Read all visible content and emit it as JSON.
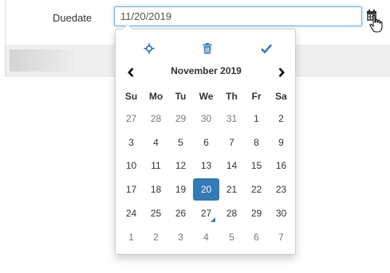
{
  "form": {
    "label": "Duedate",
    "value": "11/20/2019",
    "calendar_button_icon": "calendar-icon"
  },
  "picker": {
    "toolbar": [
      {
        "name": "today-crosshair-icon",
        "color": "#337ab7"
      },
      {
        "name": "clear-trash-icon",
        "color": "#337ab7"
      },
      {
        "name": "close-check-icon",
        "color": "#337ab7"
      }
    ],
    "prev_icon": "chevron-left-icon",
    "next_icon": "chevron-right-icon",
    "month_title": "November 2019",
    "weekdays": [
      "Su",
      "Mo",
      "Tu",
      "We",
      "Th",
      "Fr",
      "Sa"
    ],
    "weeks": [
      [
        {
          "d": "27",
          "o": true
        },
        {
          "d": "28",
          "o": true
        },
        {
          "d": "29",
          "o": true
        },
        {
          "d": "30",
          "o": true
        },
        {
          "d": "31",
          "o": true
        },
        {
          "d": "1"
        },
        {
          "d": "2"
        }
      ],
      [
        {
          "d": "3"
        },
        {
          "d": "4"
        },
        {
          "d": "5"
        },
        {
          "d": "6"
        },
        {
          "d": "7"
        },
        {
          "d": "8"
        },
        {
          "d": "9"
        }
      ],
      [
        {
          "d": "10"
        },
        {
          "d": "11"
        },
        {
          "d": "12"
        },
        {
          "d": "13"
        },
        {
          "d": "14"
        },
        {
          "d": "15"
        },
        {
          "d": "16"
        }
      ],
      [
        {
          "d": "17"
        },
        {
          "d": "18"
        },
        {
          "d": "19"
        },
        {
          "d": "20",
          "active": true
        },
        {
          "d": "21"
        },
        {
          "d": "22"
        },
        {
          "d": "23"
        }
      ],
      [
        {
          "d": "24"
        },
        {
          "d": "25"
        },
        {
          "d": "26"
        },
        {
          "d": "27",
          "today": true
        },
        {
          "d": "28"
        },
        {
          "d": "29"
        },
        {
          "d": "30"
        }
      ],
      [
        {
          "d": "1",
          "o": true
        },
        {
          "d": "2",
          "o": true
        },
        {
          "d": "3",
          "o": true
        },
        {
          "d": "4",
          "o": true
        },
        {
          "d": "5",
          "o": true
        },
        {
          "d": "6",
          "o": true
        },
        {
          "d": "7",
          "o": true
        }
      ]
    ],
    "accent_color": "#337ab7"
  }
}
